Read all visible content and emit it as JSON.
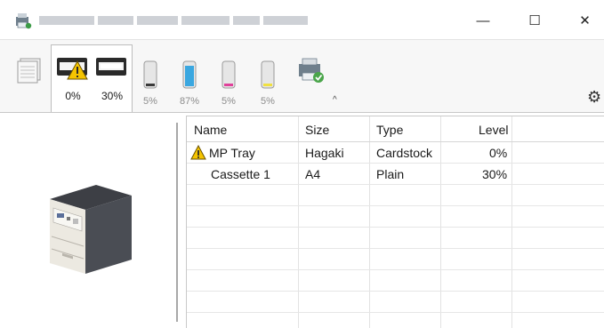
{
  "window": {
    "minimize_glyph": "—",
    "maximize_glyph": "☐",
    "close_glyph": "✕"
  },
  "toolbar": {
    "tray_levels": [
      {
        "label": "0%",
        "warning": true
      },
      {
        "label": "30%",
        "warning": false
      }
    ],
    "toner_levels": [
      {
        "label": "5%",
        "color": "#3a3a3a"
      },
      {
        "label": "87%",
        "color": "#3aa7e0"
      },
      {
        "label": "5%",
        "color": "#e0409a"
      },
      {
        "label": "5%",
        "color": "#f0e040"
      }
    ],
    "collapse_glyph": "^",
    "settings_glyph": "⚙"
  },
  "table": {
    "columns": [
      "Name",
      "Size",
      "Type",
      "Level"
    ],
    "rows": [
      {
        "name": "MP Tray",
        "size": "Hagaki",
        "type": "Cardstock",
        "level": "0%",
        "warning": true
      },
      {
        "name": "Cassette 1",
        "size": "A4",
        "type": "Plain",
        "level": "30%",
        "warning": false
      }
    ]
  },
  "colors": {
    "warning": "#f5c400",
    "accent_toner_cyan": "#3aa7e0",
    "accent_toner_magenta": "#e0409a",
    "accent_toner_yellow": "#f0e040"
  }
}
